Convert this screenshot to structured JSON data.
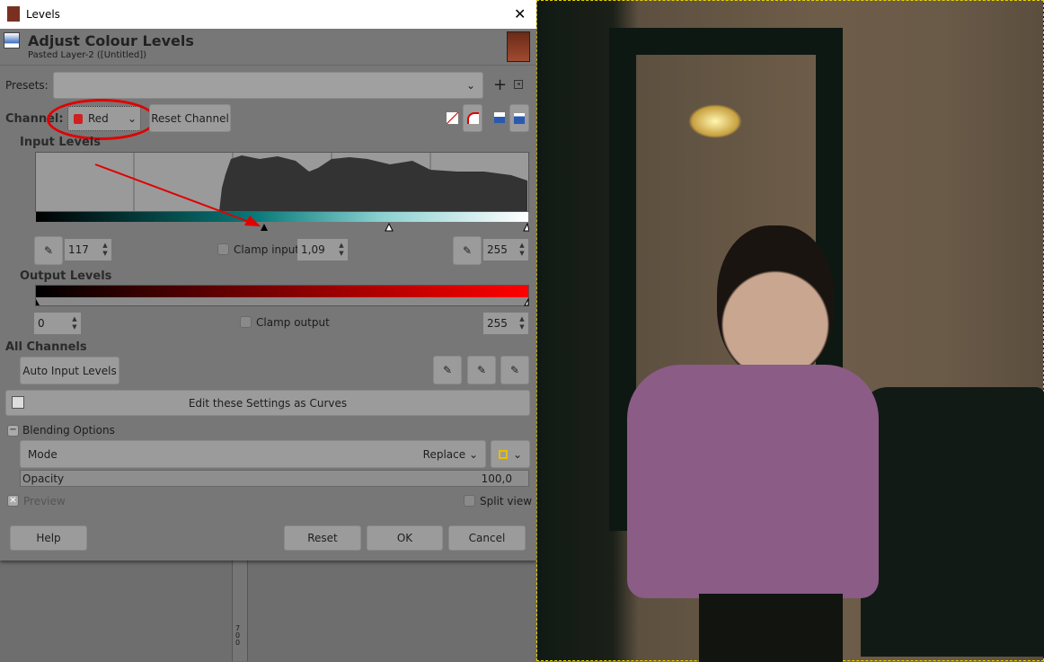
{
  "window": {
    "title": "Levels",
    "close": "✕"
  },
  "header": {
    "title": "Adjust Colour Levels",
    "subtitle": "Pasted Layer-2 ([Untitled])"
  },
  "presets": {
    "label": "Presets:",
    "value": "",
    "add": "+"
  },
  "channel": {
    "label": "Channel:",
    "value": "Red",
    "reset": "Reset Channel"
  },
  "input_levels": {
    "title": "Input Levels",
    "low": "117",
    "gamma": "1,09",
    "high": "255",
    "clamp": "Clamp input"
  },
  "output_levels": {
    "title": "Output Levels",
    "low": "0",
    "high": "255",
    "clamp": "Clamp output"
  },
  "all_channels": {
    "title": "All Channels",
    "auto": "Auto Input Levels"
  },
  "curves_button": "Edit these Settings as Curves",
  "blending": {
    "title": "Blending Options",
    "mode_label": "Mode",
    "mode_value": "Replace",
    "opacity_label": "Opacity",
    "opacity_value": "100,0"
  },
  "preview": {
    "label": "Preview",
    "checked": true
  },
  "split_view": {
    "label": "Split view"
  },
  "buttons": {
    "help": "Help",
    "reset": "Reset",
    "ok": "OK",
    "cancel": "Cancel"
  },
  "ruler": {
    "marks": "700"
  },
  "colors": {
    "annotation": "#e00000",
    "selection": "#e6d200"
  }
}
